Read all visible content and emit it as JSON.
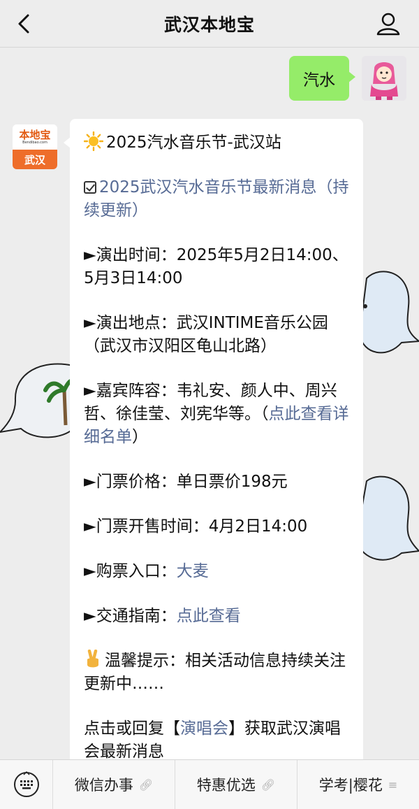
{
  "header": {
    "title": "武汉本地宝"
  },
  "outgoing": {
    "text": "汽水"
  },
  "bot": {
    "logo_text": "本地宝",
    "logo_subtext": "Bendibao.com",
    "logo_city": "武汉"
  },
  "message": {
    "title": "2025汽水音乐节-武汉站",
    "news_link": "2025武汉汽水音乐节最新消息（持续更新）",
    "time_label": "►演出时间：",
    "time_value": "2025年5月2日14:00、5月3日14:00",
    "venue_label": "►演出地点：",
    "venue_value": "武汉INTIME音乐公园（武汉市汉阳区龟山北路）",
    "guests_label": "►嘉宾阵容：",
    "guests_value": "韦礼安、颜人中、周兴哲、徐佳莹、刘宪华等。（",
    "guests_link": "点此查看详细名单",
    "guests_close": "）",
    "price_label": "►门票价格：",
    "price_value": "单日票价198元",
    "sale_label": "►门票开售时间：",
    "sale_value": "4月2日14:00",
    "buy_label": "►购票入口：",
    "buy_link": "大麦",
    "traffic_label": "►交通指南：",
    "traffic_link": "点此查看",
    "tip_label": "温馨提示：",
    "tip_value": "相关活动信息持续关注更新中……",
    "reply_prefix": "点击或回复【",
    "reply_link": "演唱会",
    "reply_suffix": "】获取武汉演唱会最新消息"
  },
  "bottom_menu": {
    "items": [
      {
        "label": "微信办事",
        "icon": "link-icon"
      },
      {
        "label": "特惠优选",
        "icon": "link-icon"
      },
      {
        "label": "学考|樱花",
        "icon": "menu-icon"
      }
    ]
  },
  "colors": {
    "bubble_out": "#95ec69",
    "link": "#576b95",
    "logo_orange": "#ee6d2a"
  }
}
